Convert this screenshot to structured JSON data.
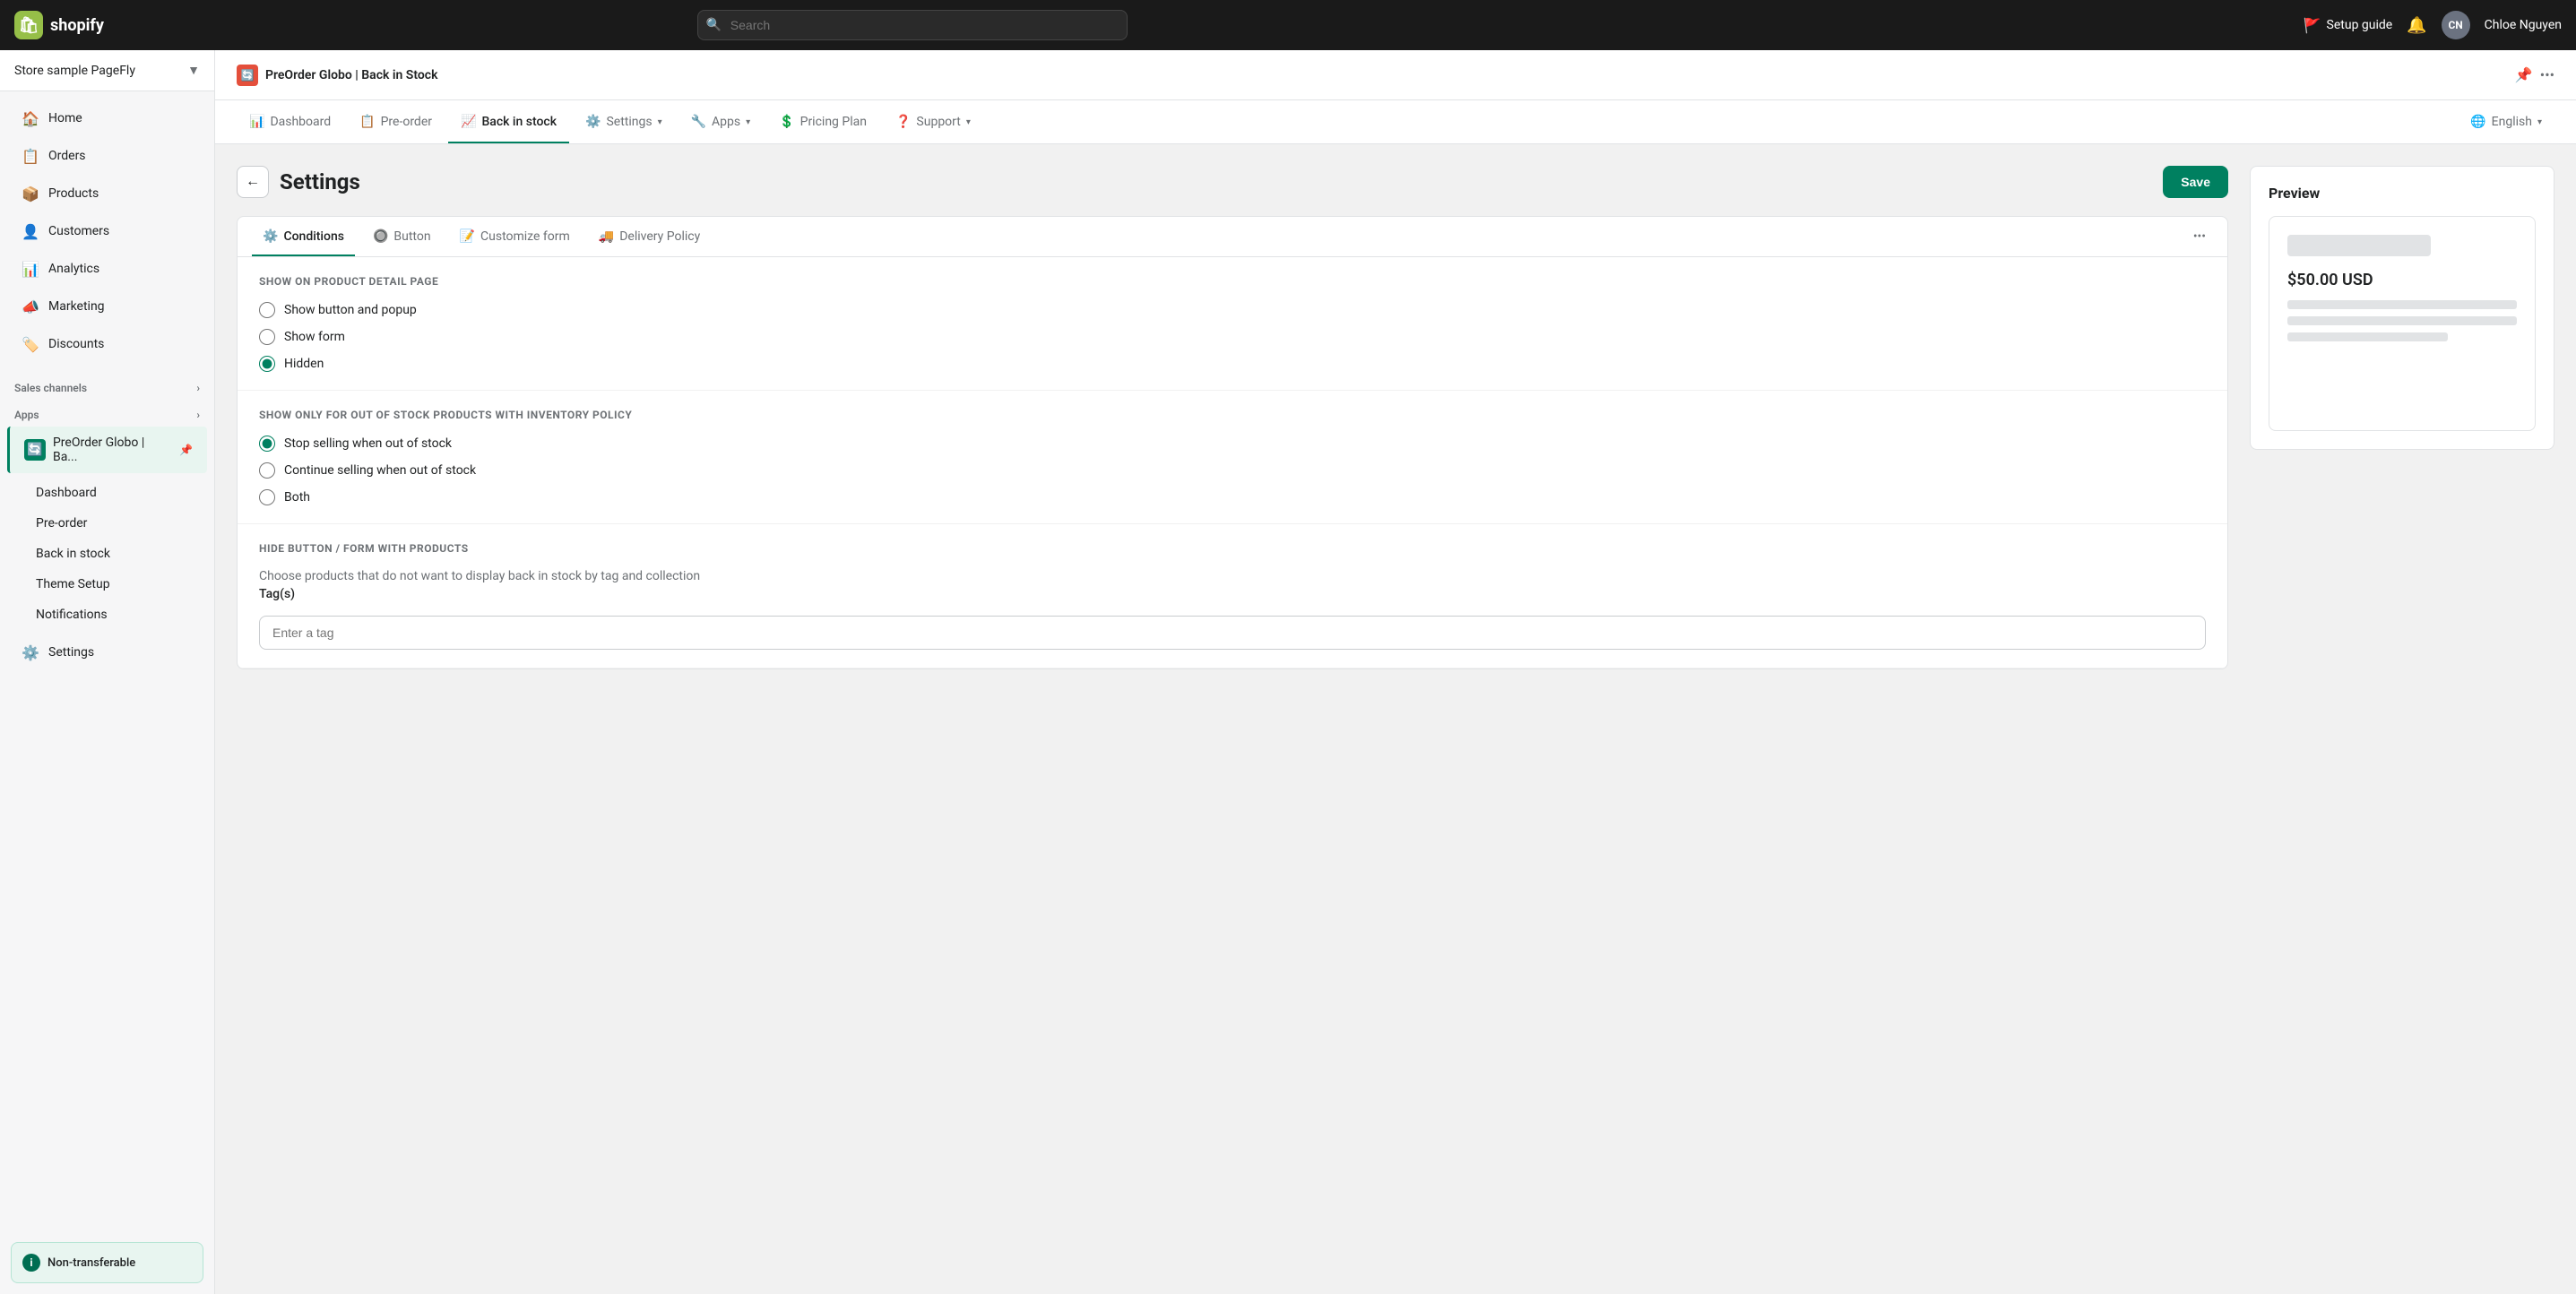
{
  "topbar": {
    "logo_text": "shopify",
    "search_placeholder": "Search",
    "setup_guide_label": "Setup guide",
    "notification_icon": "🔔",
    "avatar_initials": "CN",
    "user_name": "Chloe Nguyen"
  },
  "sidebar": {
    "store_name": "Store sample PageFly",
    "nav_items": [
      {
        "id": "home",
        "label": "Home",
        "icon": "🏠"
      },
      {
        "id": "orders",
        "label": "Orders",
        "icon": "📋"
      },
      {
        "id": "products",
        "label": "Products",
        "icon": "📦"
      },
      {
        "id": "customers",
        "label": "Customers",
        "icon": "👤"
      },
      {
        "id": "analytics",
        "label": "Analytics",
        "icon": "📊"
      },
      {
        "id": "marketing",
        "label": "Marketing",
        "icon": "📣"
      },
      {
        "id": "discounts",
        "label": "Discounts",
        "icon": "🏷️"
      }
    ],
    "sales_channels_label": "Sales channels",
    "apps_label": "Apps",
    "app_name": "PreOrder Globo | Ba...",
    "sub_items": [
      {
        "id": "dashboard",
        "label": "Dashboard"
      },
      {
        "id": "preorder",
        "label": "Pre-order"
      },
      {
        "id": "backinstock",
        "label": "Back in stock"
      },
      {
        "id": "themesetup",
        "label": "Theme Setup"
      },
      {
        "id": "notifications",
        "label": "Notifications"
      }
    ],
    "settings_label": "Settings",
    "non_transferable_label": "Non-transferable"
  },
  "app_header": {
    "app_name": "PreOrder Globo | Back in Stock"
  },
  "nav_tabs": {
    "tabs": [
      {
        "id": "dashboard",
        "label": "Dashboard",
        "icon": "📊",
        "active": false,
        "has_dropdown": false
      },
      {
        "id": "preorder",
        "label": "Pre-order",
        "icon": "📋",
        "active": false,
        "has_dropdown": false
      },
      {
        "id": "backinstock",
        "label": "Back in stock",
        "icon": "📈",
        "active": true,
        "has_dropdown": false
      },
      {
        "id": "settings",
        "label": "Settings",
        "icon": "⚙️",
        "active": false,
        "has_dropdown": true
      },
      {
        "id": "apps",
        "label": "Apps",
        "icon": "🔧",
        "active": false,
        "has_dropdown": true
      },
      {
        "id": "pricing",
        "label": "Pricing Plan",
        "icon": "💲",
        "active": false,
        "has_dropdown": false
      },
      {
        "id": "support",
        "label": "Support",
        "icon": "❓",
        "active": false,
        "has_dropdown": true
      },
      {
        "id": "english",
        "label": "English",
        "icon": "🌐",
        "active": false,
        "has_dropdown": true
      }
    ]
  },
  "settings_page": {
    "title": "Settings",
    "back_label": "←",
    "save_label": "Save",
    "card_tabs": [
      {
        "id": "conditions",
        "label": "Conditions",
        "icon": "⚙️",
        "active": true
      },
      {
        "id": "button",
        "label": "Button",
        "icon": "🔘",
        "active": false
      },
      {
        "id": "customize_form",
        "label": "Customize form",
        "icon": "📝",
        "active": false
      },
      {
        "id": "delivery_policy",
        "label": "Delivery Policy",
        "icon": "🚚",
        "active": false
      }
    ],
    "more_tabs_icon": "•••",
    "sections": {
      "show_on_product": {
        "title": "SHOW ON PRODUCT DETAIL PAGE",
        "options": [
          {
            "id": "show_button_popup",
            "label": "Show button and popup",
            "checked": false
          },
          {
            "id": "show_form",
            "label": "Show form",
            "checked": false
          },
          {
            "id": "hidden",
            "label": "Hidden",
            "checked": true
          }
        ]
      },
      "show_only_out_of_stock": {
        "title": "SHOW ONLY FOR OUT OF STOCK PRODUCTS WITH INVENTORY POLICY",
        "options": [
          {
            "id": "stop_selling",
            "label": "Stop selling when out of stock",
            "checked": true
          },
          {
            "id": "continue_selling",
            "label": "Continue selling when out of stock",
            "checked": false
          },
          {
            "id": "both",
            "label": "Both",
            "checked": false
          }
        ]
      },
      "hide_button": {
        "title": "HIDE BUTTON / FORM WITH PRODUCTS",
        "description": "Choose products that do not want to display back in stock by tag and collection",
        "tag_label": "Tag(s)",
        "tag_placeholder": "Enter a tag"
      }
    }
  },
  "preview": {
    "title": "Preview",
    "price": "$50.00 USD"
  }
}
